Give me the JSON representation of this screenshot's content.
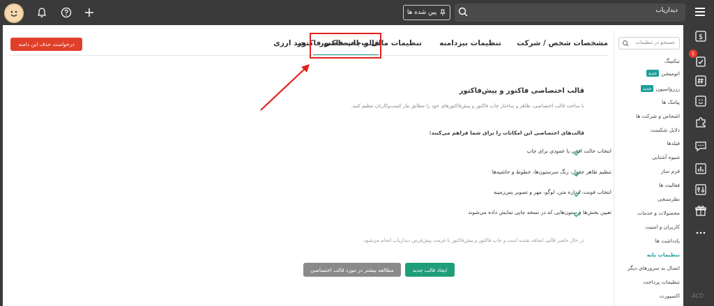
{
  "topbar": {
    "app_name": "دیداریاب",
    "pinned_label": "پین شده ها"
  },
  "rail": {
    "notification_count": "1"
  },
  "sidebar": {
    "search_placeholder": "جستجو در تنظیمات",
    "new_badge": "جدید",
    "items": [
      {
        "label": "تیکتینگ"
      },
      {
        "label": "اتومیشن"
      },
      {
        "label": "رزرواسیون"
      },
      {
        "label": "پیامک ها"
      },
      {
        "label": "اشخاص و شرکت ها"
      },
      {
        "label": "دلایل شکست"
      },
      {
        "label": "فیلدها"
      },
      {
        "label": "شیوه آشنایی"
      },
      {
        "label": "فرم ساز"
      },
      {
        "label": "فعالیت ها"
      },
      {
        "label": "نظرسنجی"
      },
      {
        "label": "محصولات و خدمات"
      },
      {
        "label": "کاربران و امنیت"
      },
      {
        "label": "یادداشت ها"
      },
      {
        "label": "تنظیمات پایه"
      },
      {
        "label": "اتصال به سرورهای دیگر"
      },
      {
        "label": "تنظیمات پرداخت"
      },
      {
        "label": "اکسپورت"
      }
    ]
  },
  "tabs": [
    {
      "label": "مشخصات شخص / شرکت"
    },
    {
      "label": "تنظیمات بیزدامنه"
    },
    {
      "label": "تنظیمات مالی و چاپ فاکتور"
    },
    {
      "label": "قالب اختصاصی فاکتور"
    },
    {
      "label": "چند ارزی"
    }
  ],
  "delete_domain_label": "درخواست حذف این دامنه",
  "content": {
    "title": "قالب اختصاصی فاکتور و پیش‌فاکتور",
    "description": "با ساخت قالب اختصاصی، ظاهر و ساختار چاپ فاکتور و پیش‌فاکتورهای خود را مطابق نیاز کسب‌وکارتان تنظیم کنید.",
    "features_title": "قالب‌های اختصاصی این امکانات را برای شما فراهم می‌کنند:",
    "features": [
      "انتخاب حالت افقی یا عمودی برای چاپ",
      "تنظیم ظاهر جدول، رنگ سرستون‌ها، خطوط و حاشیه‌ها",
      "انتخاب فونت، اندازه متن، لوگو، مهر و تصویر پس‌زمینه",
      "تعیین بخش‌ها و ستون‌هایی که در نسخه چاپی نمایش داده می‌شوند"
    ],
    "note": "در حال حاضر قالبی اضافه نشده است و چاپ فاکتور و پیش‌فاکتور با فرمت پیش‌فرض دیداریاب انجام می‌شود.",
    "create_button": "ایجاد قالب جدید",
    "learn_more_button": "مطالعه بیشتر در مورد قالب اختصاصی"
  },
  "colors": {
    "accent": "#1f9e9a",
    "primary_button": "#1f9e7a",
    "danger": "#e0402a",
    "annotation": "#e3211c"
  }
}
